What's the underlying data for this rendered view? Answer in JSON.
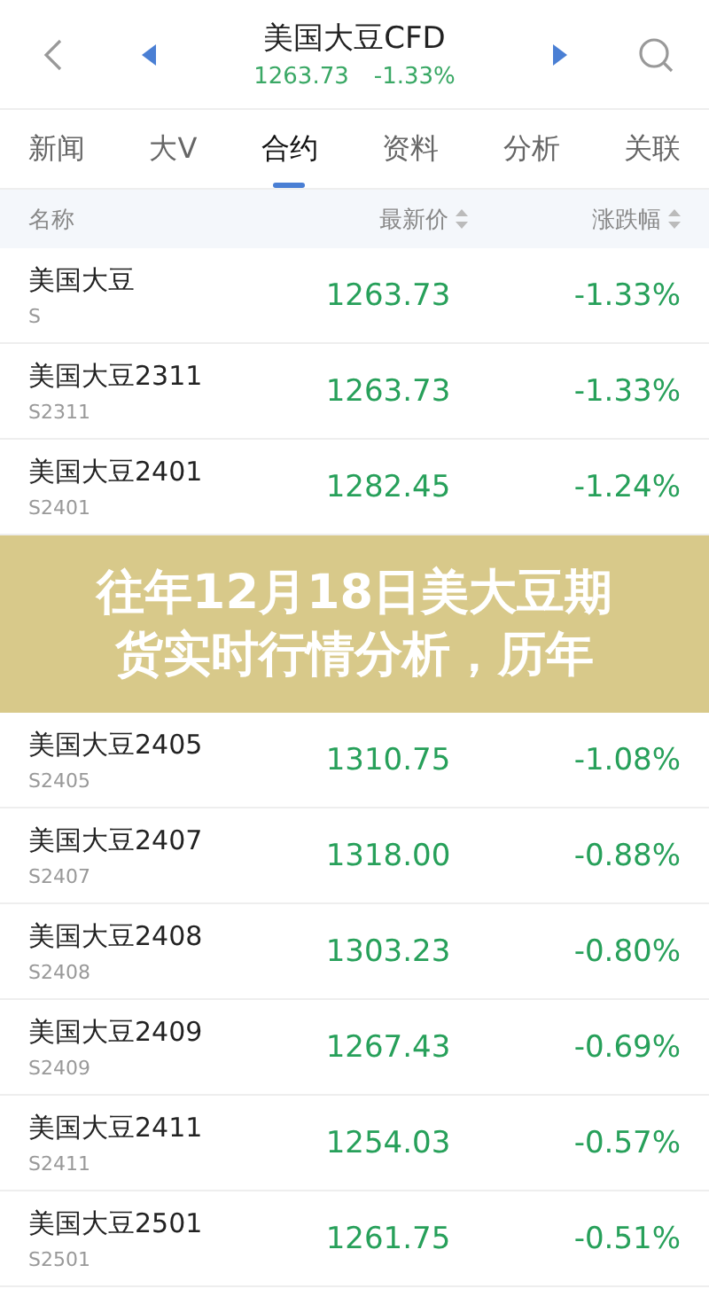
{
  "header": {
    "title": "美国大豆CFD",
    "price": "1263.73",
    "change": "-1.33%"
  },
  "tabs": [
    {
      "label": "新闻",
      "selected": false
    },
    {
      "label": "大V",
      "selected": false
    },
    {
      "label": "合约",
      "selected": true
    },
    {
      "label": "资料",
      "selected": false
    },
    {
      "label": "分析",
      "selected": false
    },
    {
      "label": "关联",
      "selected": false
    }
  ],
  "columns": [
    "名称",
    "最新价",
    "涨跌幅"
  ],
  "rows": [
    {
      "name": "美国大豆",
      "code": "S",
      "price": "1263.73",
      "change": "-1.33%"
    },
    {
      "name": "美国大豆2311",
      "code": "S2311",
      "price": "1263.73",
      "change": "-1.33%"
    },
    {
      "name": "美国大豆2401",
      "code": "S2401",
      "price": "1282.45",
      "change": "-1.24%"
    },
    {
      "kind": "banner",
      "lines": [
        "往年12月18日美大豆期",
        "货实时行情分析，历年"
      ]
    },
    {
      "name": "美国大豆2405",
      "code": "S2405",
      "price": "1310.75",
      "change": "-1.08%"
    },
    {
      "name": "美国大豆2407",
      "code": "S2407",
      "price": "1318.00",
      "change": "-0.88%"
    },
    {
      "name": "美国大豆2408",
      "code": "S2408",
      "price": "1303.23",
      "change": "-0.80%"
    },
    {
      "name": "美国大豆2409",
      "code": "S2409",
      "price": "1267.43",
      "change": "-0.69%"
    },
    {
      "name": "美国大豆2411",
      "code": "S2411",
      "price": "1254.03",
      "change": "-0.57%"
    },
    {
      "name": "美国大豆2501",
      "code": "S2501",
      "price": "1261.75",
      "change": "-0.51%"
    }
  ]
}
